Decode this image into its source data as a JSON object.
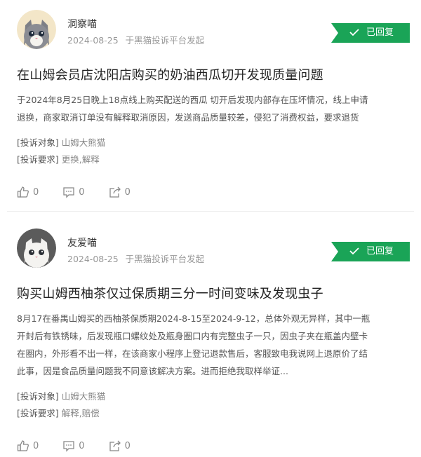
{
  "posts": [
    {
      "username": "洞察喵",
      "date": "2024-08-25",
      "source": "于黑猫投诉平台发起",
      "status": "已回复",
      "title": "在山姆会员店沈阳店购买的奶油西瓜切开发现质量问题",
      "content_lines": [
        "于2024年8月25日晚上18点线上购买配送的西瓜 切开后发现内部存在压坏情况，线上申请",
        "退换，商家取消订单没有解释取消原因，发送商品质量较差，侵犯了消费权益，要求退货"
      ],
      "target_key": "[投诉对象]",
      "target_value": "山姆大熊猫",
      "request_key": "[投诉要求]",
      "request_value": "更换,解释",
      "likes": "0",
      "comments": "0",
      "shares": "0"
    },
    {
      "username": "友爱喵",
      "date": "2024-08-25",
      "source": "于黑猫投诉平台发起",
      "status": "已回复",
      "title": "购买山姆西柚茶仅过保质期三分一时间变味及发现虫子",
      "content_lines": [
        "8月17在番禺山姆买的西柚茶保质期2024-8-15至2024-9-12，总体外观无异样，其中一瓶",
        "开封后有铁锈味，后发现瓶口螺纹处及瓶身圈口内有完整虫子一只，因虫子夹在瓶盖内壁卡",
        "在圈内，外形看不出一样，在该商家小程序上登记退款售后，客服致电我说网上退原价了结",
        "此事，因是食品质量问题我不同意该解决方案。进而拒绝我取样举证..."
      ],
      "target_key": "[投诉对象]",
      "target_value": "山姆大熊猫",
      "request_key": "[投诉要求]",
      "request_value": "解释,赔偿",
      "likes": "0",
      "comments": "0",
      "shares": "0"
    }
  ],
  "colors": {
    "accent": "#1aa457",
    "muted": "#999999",
    "text": "#222222"
  },
  "icons": {
    "avatar1": "gray-cat-avatar",
    "avatar2": "white-cat-avatar",
    "check": "check-icon",
    "like": "thumbs-up-icon",
    "comment": "comment-icon",
    "share": "share-icon"
  }
}
